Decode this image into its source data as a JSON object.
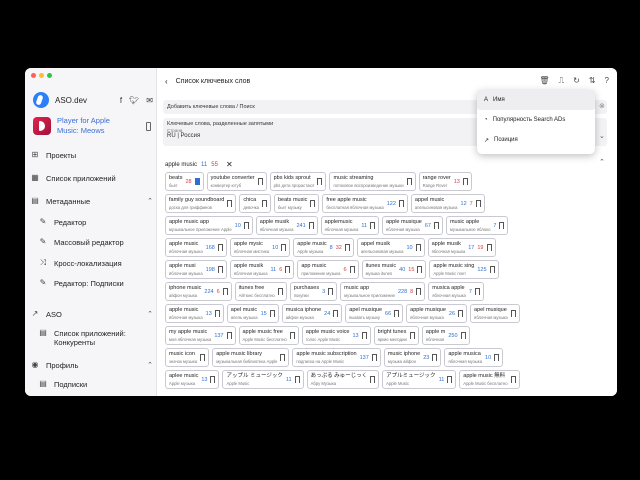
{
  "window": {
    "colors": {
      "close": "#ff5f57",
      "min": "#febc2e",
      "max": "#28c840"
    }
  },
  "brand": {
    "name": "ASO.dev"
  },
  "app": {
    "title": "Player for Apple Music: Meows"
  },
  "nav": {
    "projects": "Проекты",
    "app_list": "Список приложений",
    "metadata": "Метаданные",
    "editor": "Редактор",
    "bulk_editor": "Массовый редактор",
    "cross_loc": "Кросс-локализация",
    "editor_subs": "Редактор: Подписки",
    "aso": "ASO",
    "app_list_comp": "Список приложений: Конкуренты",
    "profile": "Профиль",
    "subscriptions": "Подписки"
  },
  "header": {
    "title": "Список ключевых слов"
  },
  "form": {
    "add_keywords": "Добавить ключевые слова / Поиск",
    "comma_label": "Ключевые слова, разделенные запятыми",
    "country_label": "Страна",
    "country_value": "RU | Россия"
  },
  "dropdown": {
    "items": [
      "Имя",
      "Популярность Search ADs",
      "Позиция"
    ]
  },
  "keyword": {
    "name": "apple music",
    "pop": "11",
    "rank": "55"
  },
  "chip_rows": [
    [
      {
        "k": "beats",
        "t": "бьет",
        "r": "28",
        "b": true
      },
      {
        "k": "youtube converter",
        "t": "конвертер ютуб"
      },
      {
        "k": "pbs kids sprout",
        "t": "pbs дети прорастают"
      },
      {
        "k": "music streaming",
        "t": "потоковое воспроизведение музыки"
      },
      {
        "k": "range rover",
        "t": "Range Rover",
        "r": "13"
      }
    ],
    [
      {
        "k": "family guy soundboard",
        "t": "доска для гриффинов"
      },
      {
        "k": "chica",
        "t": "девочка"
      },
      {
        "k": "beats music",
        "t": "бьет музыку"
      },
      {
        "k": "free apple music",
        "t": "бесплатная яблочная музыка",
        "p": "122"
      },
      {
        "k": "appel music",
        "t": "апельсиновая музыка",
        "p": "12",
        "r": "7"
      }
    ],
    [
      {
        "k": "apple music app",
        "t": "музыкальное приложение Apple",
        "p": "10"
      },
      {
        "k": "apple musik",
        "t": "яблочная музыка",
        "p": "241"
      },
      {
        "k": "applemusic",
        "t": "яблочная музыка",
        "p": "11"
      },
      {
        "k": "apple musique",
        "t": "яблочная музыка",
        "p": "67"
      },
      {
        "k": "music apple",
        "t": "музыкальное яблоко",
        "p": "7"
      }
    ],
    [
      {
        "k": "apple music",
        "t": "яблочная музыка",
        "p": "168"
      },
      {
        "k": "apple mysic",
        "t": "яблочная мистика",
        "p": "10"
      },
      {
        "k": "apple music",
        "t": "Apple музыка",
        "p": "8",
        "r": "32"
      },
      {
        "k": "appel musik",
        "t": "апельсиновая музыка",
        "p": "10"
      },
      {
        "k": "apple musik",
        "t": "яблочная музыка",
        "p": "17",
        "r": "19"
      }
    ],
    [
      {
        "k": "apple musi",
        "t": "яблочная музыка",
        "p": "198"
      },
      {
        "k": "apple musik",
        "t": "яблочная музыка",
        "p": "11",
        "r": "6"
      },
      {
        "k": "app music",
        "t": "приложение музыка",
        "r": "6"
      },
      {
        "k": "itunes music",
        "t": "музыка itunes",
        "p": "40",
        "r": "15"
      },
      {
        "k": "apple music sing",
        "t": "Apple Music поет",
        "p": "125"
      }
    ],
    [
      {
        "k": "iphone music",
        "t": "айфон музыка",
        "p": "224",
        "r": "6"
      },
      {
        "k": "itunes free",
        "t": "Айтюнс бесплатно"
      },
      {
        "k": "purchases",
        "t": "покупки",
        "p": "3"
      },
      {
        "k": "music app",
        "t": "музыкальное приложение",
        "p": "228",
        "r": "8"
      },
      {
        "k": "musica apple",
        "t": "яблочная музыка",
        "p": "7"
      }
    ],
    [
      {
        "k": "apple music",
        "t": "яблочная музыка",
        "p": "13"
      },
      {
        "k": "apel music",
        "t": "апель музыка",
        "p": "15"
      },
      {
        "k": "musica iphone",
        "t": "айфон музыка",
        "p": "24"
      },
      {
        "k": "apel musique",
        "t": "вызвать музыку",
        "p": "66"
      },
      {
        "k": "apple musique",
        "t": "яблочная музыка",
        "p": "26"
      },
      {
        "k": "apel musique",
        "t": "яблочная музыка"
      }
    ],
    [
      {
        "k": "my apple music",
        "t": "моя яблочная музыка",
        "p": "137"
      },
      {
        "k": "apple music free",
        "t": "Apple Music бесплатно"
      },
      {
        "k": "apple music voice",
        "t": "голос Apple Music",
        "p": "13"
      },
      {
        "k": "bright tunes",
        "t": "яркие мелодии"
      },
      {
        "k": "apple m",
        "t": "яблочная",
        "p": "250"
      }
    ],
    [
      {
        "k": "music icon",
        "t": "значок музыка"
      },
      {
        "k": "apple music library",
        "t": "музыкальная библиотека Apple"
      },
      {
        "k": "apple music subscription",
        "t": "подписка на Apple Music",
        "p": "137"
      },
      {
        "k": "music iphone",
        "t": "музыка айфон",
        "p": "23"
      },
      {
        "k": "apple musica",
        "t": "яблочная музыка",
        "p": "10"
      }
    ],
    [
      {
        "k": "aplee music",
        "t": "Apple музыка",
        "p": "13"
      },
      {
        "k": "アップル ミュージック",
        "t": "Apple Music",
        "p": "11"
      },
      {
        "k": "あっぷる みゅーじっく",
        "t": "Абру Музыка"
      },
      {
        "k": "アプルミュージック",
        "t": "Apple Music",
        "p": "11"
      },
      {
        "k": "apple music 無料",
        "t": "Apple Music бесплатно"
      }
    ]
  ]
}
